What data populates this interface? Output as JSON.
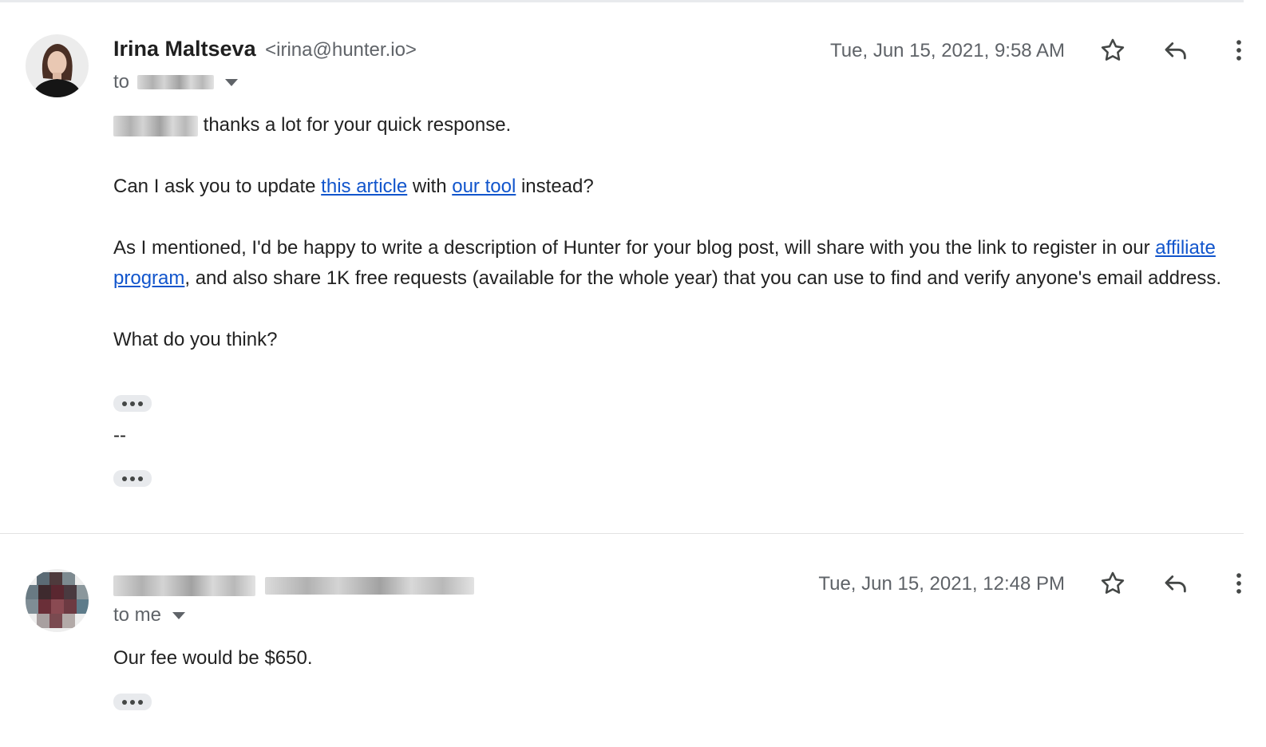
{
  "thread": {
    "messages": [
      {
        "sender_name": "Irina Maltseva",
        "sender_email": "<irina@hunter.io>",
        "to_prefix": "to",
        "date": "Tue, Jun 15, 2021, 9:58 AM",
        "body": {
          "greeting_rest": " thanks a lot for your quick response.",
          "p2_a": "Can I ask you to update ",
          "p2_link1": "this article",
          "p2_b": " with ",
          "p2_link2": "our tool",
          "p2_c": " instead?",
          "p3_a": "As I mentioned, I'd be happy to write a description of Hunter for your blog post, will share with you the link to register in our ",
          "p3_link": "affiliate program",
          "p3_b": ", and also share 1K free requests (available for the whole year) that you can use to find and verify anyone's email address.",
          "p4": "What do you think?",
          "sig_sep": "--"
        }
      },
      {
        "to_text": "to me",
        "date": "Tue, Jun 15, 2021, 12:48 PM",
        "body": {
          "p1": "Our fee would be $650."
        }
      }
    ]
  },
  "icons": {
    "star": "star-icon",
    "reply": "reply-icon",
    "more": "more-vertical-icon",
    "dropdown": "chevron-down-icon",
    "trimmed": "show-trimmed-content-icon"
  },
  "colors": {
    "link": "#1155cc",
    "text": "#222222",
    "meta": "#5f6368",
    "pill": "#e8eaed"
  }
}
